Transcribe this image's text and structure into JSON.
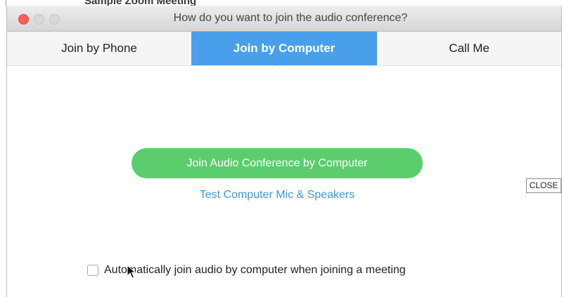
{
  "background_window": {
    "title_fragment": "Sample Zoom Meeting"
  },
  "window": {
    "title": "How do you want to join the audio conference?"
  },
  "tabs": [
    {
      "label": "Join by Phone",
      "selected": false
    },
    {
      "label": "Join by Computer",
      "selected": true
    },
    {
      "label": "Call Me",
      "selected": false
    }
  ],
  "content": {
    "join_button_label": "Join Audio Conference by Computer",
    "test_link_label": "Test Computer Mic & Speakers",
    "auto_join_label": "Automatically join audio by computer when joining a meeting",
    "auto_join_checked": false
  },
  "overlay": {
    "close_label": "CLOSE"
  },
  "colors": {
    "tab_selected": "#4a9fea",
    "join_button": "#5ccd6c",
    "link": "#3e98d6",
    "close_dot": "#fc5f57"
  }
}
